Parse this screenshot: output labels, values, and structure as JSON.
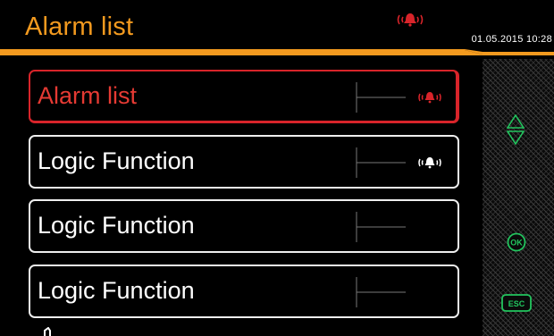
{
  "header": {
    "title": "Alarm list",
    "datetime": "01.05.2015 10:28",
    "alarm_icon": "alarm-bell-icon"
  },
  "menu": {
    "items": [
      {
        "label": "Alarm list",
        "selected": true,
        "icon": "alarm-bell-icon"
      },
      {
        "label": "Logic Function",
        "selected": false,
        "icon": "bell-icon"
      },
      {
        "label": "Logic Function",
        "selected": false,
        "icon": ""
      },
      {
        "label": "Logic Function",
        "selected": false,
        "icon": ""
      }
    ]
  },
  "sidebar": {
    "up_down_icon": "up-down-arrows-icon",
    "ok_label": "OK",
    "esc_label": "ESC"
  },
  "colors": {
    "accent": "#f39a1f",
    "alarm": "#d8242a",
    "sidebar_icons": "#22c55e"
  }
}
